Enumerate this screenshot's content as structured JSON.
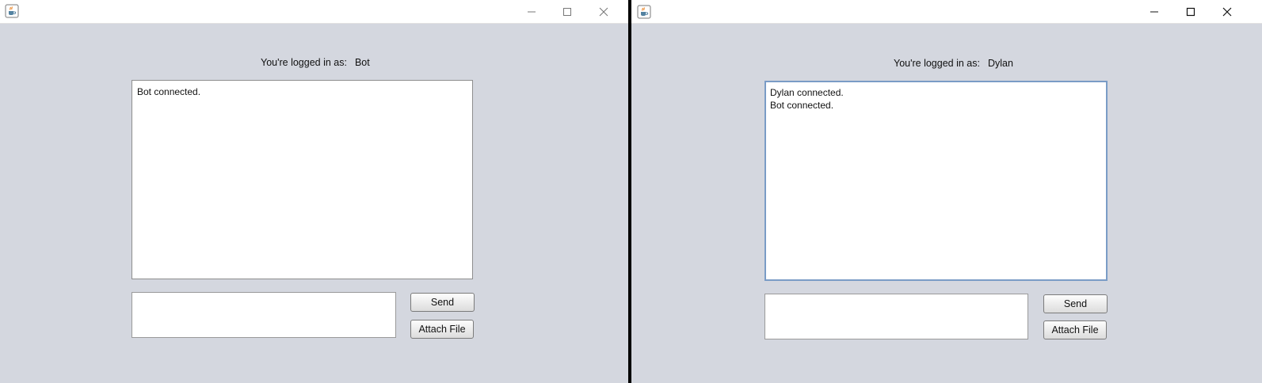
{
  "windows": [
    {
      "logged_in_label": "You're logged in as:",
      "username": "Bot",
      "messages": [
        "Bot connected."
      ],
      "send_label": "Send",
      "attach_label": "Attach File"
    },
    {
      "logged_in_label": "You're logged in as:",
      "username": "Dylan",
      "messages": [
        "Dylan connected.",
        "Bot connected."
      ],
      "send_label": "Send",
      "attach_label": "Attach File"
    }
  ],
  "icons": {
    "app": "java-coffee-cup-icon",
    "minimize": "minimize-icon",
    "maximize": "maximize-icon",
    "close": "close-icon"
  }
}
